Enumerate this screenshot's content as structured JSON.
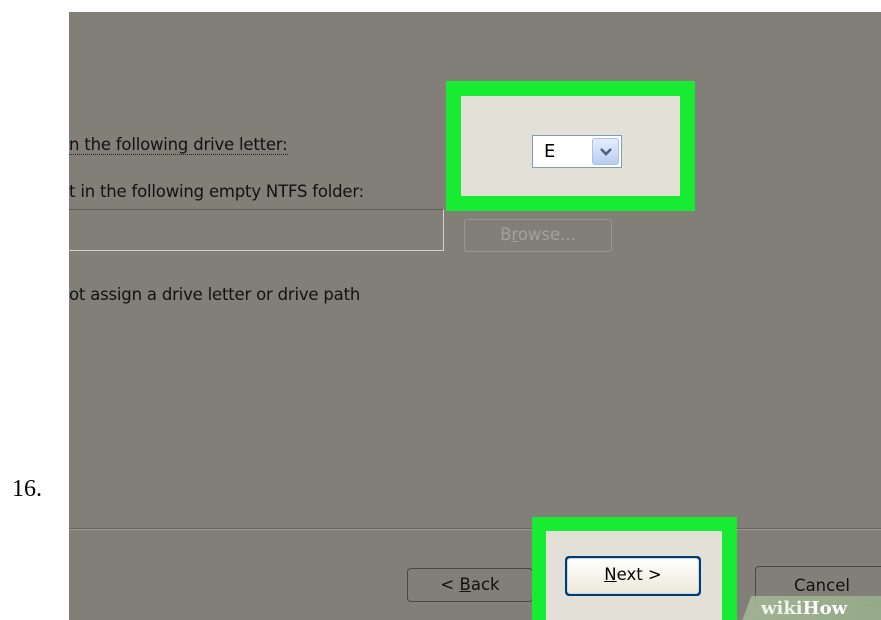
{
  "step_number": "16.",
  "dialog": {
    "option_drive_letter_label": "n the following drive letter:",
    "option_ntfs_folder_label": "t in the following empty NTFS folder:",
    "option_no_assign_label": "ot assign a drive letter or drive path",
    "ntfs_folder_path_value": "",
    "drive_letter_value": "E",
    "browse_prefix": "B",
    "browse_mnemonic": "r",
    "browse_suffix": "owse...",
    "buttons": {
      "back_prefix": "< ",
      "back_mnemonic": "B",
      "back_suffix": "ack",
      "next_mnemonic": "N",
      "next_suffix": "ext >",
      "cancel_label": "Cancel"
    }
  },
  "watermark": {
    "part1": "wiki",
    "part2": "How"
  },
  "colors": {
    "highlight": "#18ec32",
    "dialog_background": "#817f78",
    "highlight_inner": "#e3e0d7"
  },
  "icons": {
    "dropdown_arrow": "chevron-down-icon"
  }
}
